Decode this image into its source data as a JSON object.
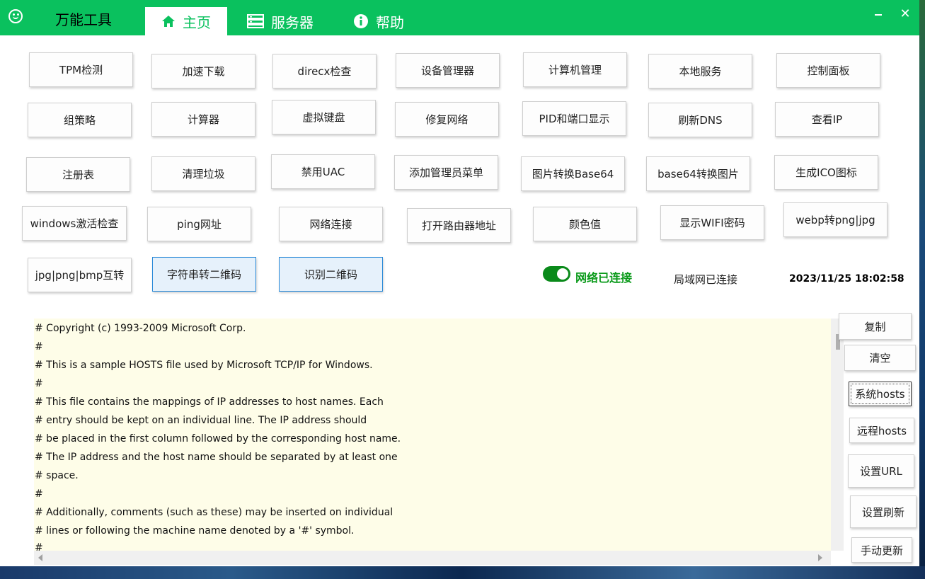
{
  "app": {
    "title": "万能工具"
  },
  "tabs": [
    {
      "label": "主页",
      "icon": "home-icon"
    },
    {
      "label": "服务器",
      "icon": "server-icon"
    },
    {
      "label": "帮助",
      "icon": "info-icon"
    }
  ],
  "window_controls": {
    "minimize": "minimize-icon",
    "close": "✕"
  },
  "tools": [
    "TPM检测",
    "加速下载",
    "direcx检查",
    "设备管理器",
    "计算机管理",
    "本地服务",
    "控制面板",
    "组策略",
    "计算器",
    "虚拟键盘",
    "修复网络",
    "PID和端口显示",
    "刷新DNS",
    "查看IP",
    "注册表",
    "清理垃圾",
    "禁用UAC",
    "添加管理员菜单",
    "图片转换Base64",
    "base64转换图片",
    "生成ICO图标",
    "windows激活检查",
    "ping网址",
    "网络连接",
    "打开路由器地址",
    "颜色值",
    "显示WIFI密码",
    "webp转png|jpg",
    "jpg|png|bmp互转",
    "字符串转二维码",
    "识别二维码"
  ],
  "status": {
    "toggle_on": true,
    "network": "网络已连接",
    "lan": "局域网已连接",
    "datetime": "2023/11/25 18:02:58"
  },
  "hosts_text": [
    "# Copyright (c) 1993-2009 Microsoft Corp.",
    "#",
    "# This is a sample HOSTS file used by Microsoft TCP/IP for Windows.",
    "#",
    "# This file contains the mappings of IP addresses to host names. Each",
    "# entry should be kept on an individual line. The IP address should",
    "# be placed in the first column followed by the corresponding host name.",
    "# The IP address and the host name should be separated by at least one",
    "# space.",
    "#",
    "# Additionally, comments (such as these) may be inserted on individual",
    "# lines or following the machine name denoted by a '#' symbol.",
    "#"
  ],
  "side_buttons": [
    "复制",
    "清空",
    "系统hosts",
    "远程hosts",
    "设置URL",
    "设置刷新",
    "手动更新"
  ],
  "colors": {
    "titlebar": "#0ac15e",
    "textarea_bg": "#fefde8",
    "net_ok": "#0a9a1a"
  }
}
